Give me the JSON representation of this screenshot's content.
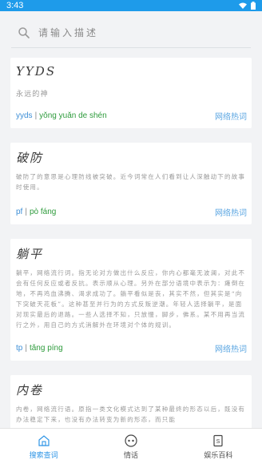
{
  "status_bar": {
    "time": "3:43"
  },
  "search": {
    "placeholder": "请输入描述"
  },
  "cards": [
    {
      "title": "YYDS",
      "description": "永远的神",
      "abbr": "yyds",
      "pinyin": "yǒng yuǎn de shén",
      "category": "网络热词"
    },
    {
      "title": "破防",
      "description": "破防了的意思是心理防线被突破。近今词常在人们看到让人深触动下的故事时使用。",
      "abbr": "pf",
      "pinyin": "pò fáng",
      "category": "网络热词"
    },
    {
      "title": "躺平",
      "description": "躺平，网络流行词。指无论对方做出什么反应，你内心都毫无波澜，对此不会有任何反应或者反抗。表示顺从心理。另外在部分语境中表示为：瘫倒在地，不再鸡血沸腾、渴求成功了。躺平看似是丧，其实不然，但其实是“向下突破天花板”。这种甚至并行为的方式反叛逆潮。年轻人选择躺平，是面对现实最后的退路。一些人选择不知，只放慢，脚步，佛系。某不用再当流行之外，用自己的方式消解外在环境对个体的规训。",
      "abbr": "tp",
      "pinyin": "tǎng píng",
      "category": "网络热词"
    },
    {
      "title": "内卷",
      "description": "内卷，网络流行语。原指一类文化模式达到了某种最终的形态以后，既没有办法稳定下来，也没有办法转变为新的形态，而只能",
      "abbr": "",
      "pinyin": "",
      "category": ""
    }
  ],
  "tabs": [
    {
      "label": "搜索查词",
      "icon": "home-icon",
      "active": true
    },
    {
      "label": "情话",
      "icon": "chat-icon",
      "active": false
    },
    {
      "label": "娱乐百科",
      "icon": "book-icon",
      "active": false
    }
  ],
  "colors": {
    "status_bar": "#1e9bea",
    "abbr": "#3d8fd6",
    "pinyin": "#2e9b3c",
    "category": "#5ba6e2",
    "tab_active": "#2e95e6"
  }
}
